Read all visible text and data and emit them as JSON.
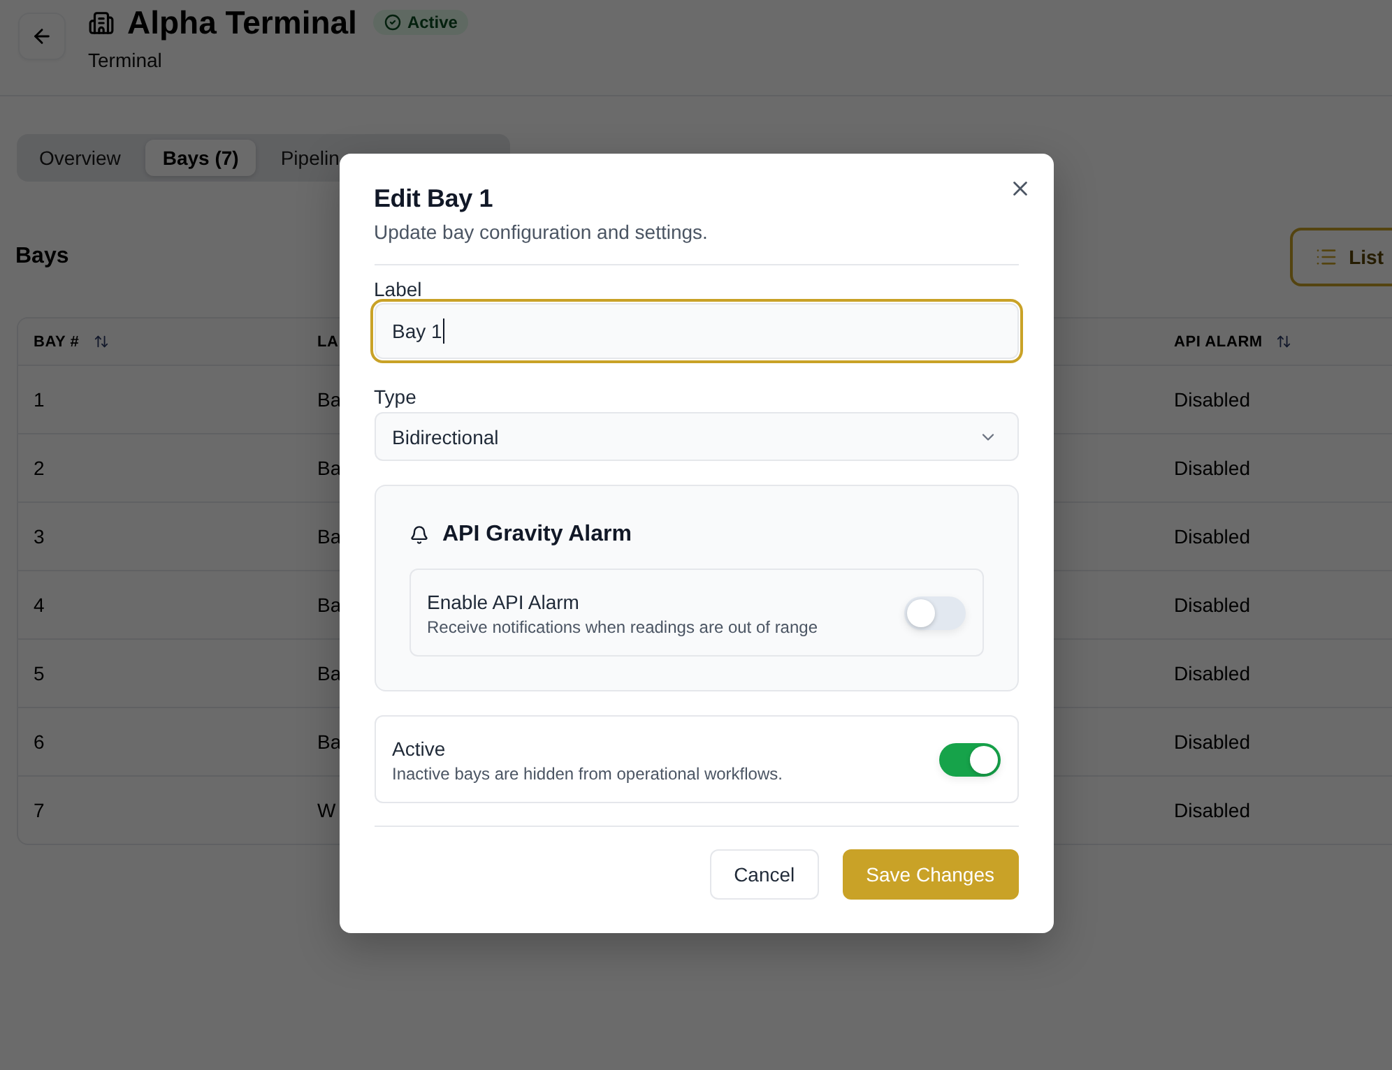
{
  "page": {
    "title": "Alpha Terminal",
    "status": "Active",
    "subtitle": "Terminal"
  },
  "tabs": [
    {
      "label": "Overview",
      "selected": false
    },
    {
      "label": "Bays (7)",
      "selected": true
    },
    {
      "label": "Pipelin",
      "selected": false
    }
  ],
  "section": {
    "title": "Bays",
    "view_button": "List"
  },
  "table": {
    "columns": [
      {
        "label": "BAY #",
        "sortable": true
      },
      {
        "label": "LA",
        "sortable": false
      },
      {
        "label": "API ALARM",
        "sortable": true
      }
    ],
    "rows": [
      [
        "1",
        "Ba",
        "Disabled"
      ],
      [
        "2",
        "Ba",
        "Disabled"
      ],
      [
        "3",
        "Ba",
        "Disabled"
      ],
      [
        "4",
        "Ba",
        "Disabled"
      ],
      [
        "5",
        "Ba",
        "Disabled"
      ],
      [
        "6",
        "Ba",
        "Disabled"
      ],
      [
        "7",
        "W",
        "Disabled"
      ]
    ]
  },
  "dialog": {
    "title": "Edit Bay 1",
    "subtitle": "Update bay configuration and settings.",
    "fields": [
      {
        "kind": "text",
        "label": "Label",
        "value": "Bay 1",
        "focused": true
      },
      {
        "kind": "select",
        "label": "Type",
        "value": "Bidirectional"
      }
    ],
    "alarm_panel": {
      "title": "API Gravity Alarm",
      "setting": {
        "label": "Enable API Alarm",
        "description": "Receive notifications when readings are out of range",
        "on": false
      }
    },
    "active_setting": {
      "label": "Active",
      "description": "Inactive bays are hidden from operational workflows.",
      "on": true
    },
    "buttons": [
      {
        "kind": "secondary",
        "label": "Cancel"
      },
      {
        "kind": "primary",
        "label": "Save Changes"
      }
    ]
  }
}
